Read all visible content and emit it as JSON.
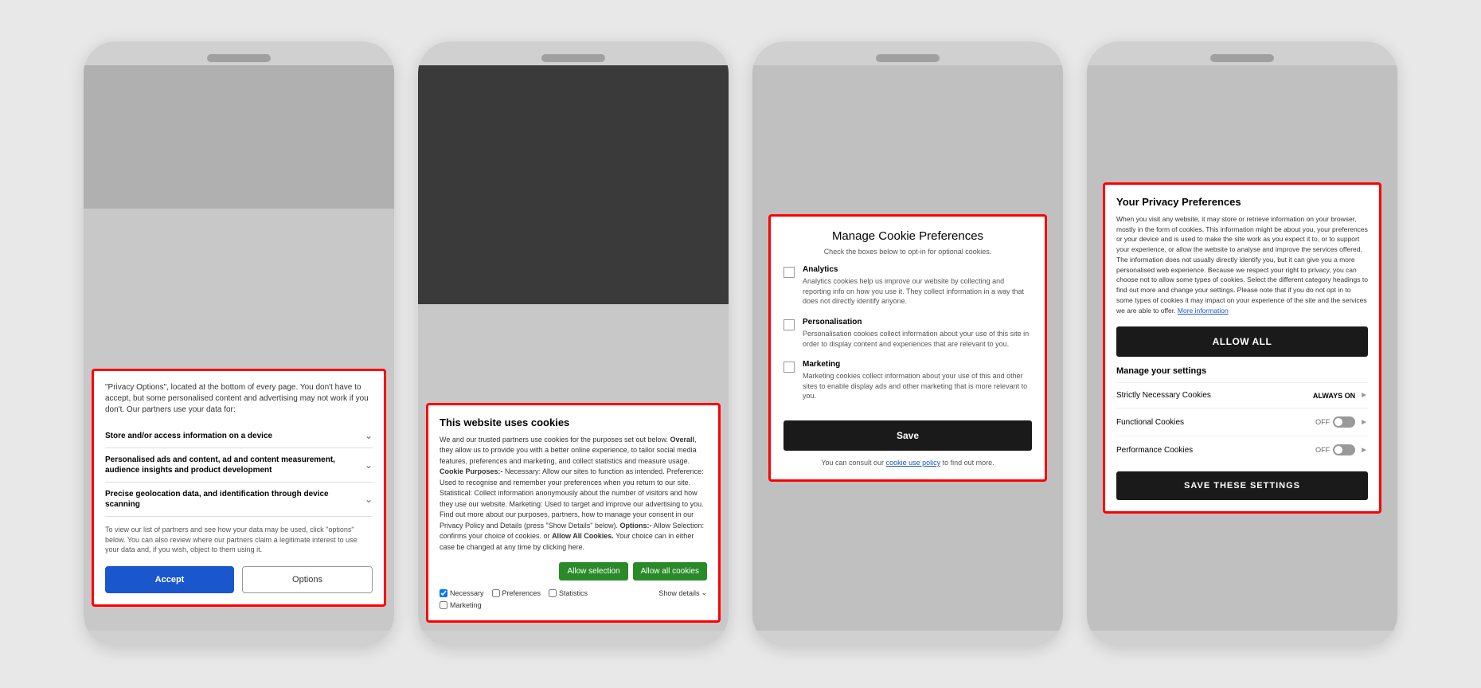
{
  "panel1": {
    "intro_text": "\"Privacy Options\", located at the bottom of every page. You don't have to accept, but some personalised content and advertising may not work if you don't. Our partners use your data for:",
    "items": [
      {
        "label": "Store and/or access information on a device"
      },
      {
        "label": "Personalised ads and content, ad and content measurement, audience insights and product development"
      },
      {
        "label": "Precise geolocation data, and identification through device scanning"
      }
    ],
    "partner_text": "To view our list of partners and see how your data may be used, click \"options\" below. You can also review where our partners claim a legitimate interest to use your data and, if you wish, object to them using it.",
    "accept_label": "Accept",
    "options_label": "Options"
  },
  "panel2": {
    "title": "This website uses cookies",
    "body_1": "We and our trusted partners use cookies for the purposes set out below. ",
    "body_bold_1": "Overall",
    "body_2": ", they allow us to provide you with a better online experience, to tailor social media features, preferences and marketing, and collect statistics and measure usage. ",
    "body_bold_2": "Cookie Purposes:-",
    "body_3": " Necessary: Allow our sites to function as intended. Preference: Used to recognise and remember your preferences when you return to our site. Statistical: Collect information anonymously about the number of visitors and how they use our website. Marketing: Used to target and improve our advertising to you. Find out more about our purposes, partners, how to manage your consent in our Privacy Policy and Details (press \"Show Details\" below). ",
    "body_bold_3": "Options:-",
    "body_4": " Allow Selection: confirms your choice of cookies. or ",
    "body_bold_4": "Allow All Cookies.",
    "body_5": " Your choice can in either case be changed at any time by clicking here.",
    "allow_selection_label": "Allow selection",
    "allow_all_label": "Allow all cookies",
    "checkboxes": [
      {
        "label": "Necessary",
        "checked": true
      },
      {
        "label": "Preferences",
        "checked": false
      },
      {
        "label": "Statistics",
        "checked": false
      },
      {
        "label": "Marketing",
        "checked": false
      }
    ],
    "show_details_label": "Show details"
  },
  "panel3": {
    "title": "Manage Cookie Preferences",
    "subtitle": "Check the boxes below to opt-in for optional cookies.",
    "items": [
      {
        "label": "Analytics",
        "description": "Analytics cookies help us improve our website by collecting and reporting info on how you use it. They collect information in a way that does not directly identify anyone.",
        "checked": false
      },
      {
        "label": "Personalisation",
        "description": "Personalisation cookies collect information about your use of this site in order to display content and experiences that are relevant to you.",
        "checked": false
      },
      {
        "label": "Marketing",
        "description": "Marketing cookies collect information about your use of this and other sites to enable display ads and other marketing that is more relevant to you.",
        "checked": false
      }
    ],
    "save_label": "Save",
    "policy_text": "You can consult our",
    "policy_link": "cookie use policy",
    "policy_text2": "to find out more."
  },
  "panel4": {
    "title": "Your Privacy Preferences",
    "body": "When you visit any website, it may store or retrieve information on your browser, mostly in the form of cookies. This information might be about you, your preferences or your device and is used to make the site work as you expect it to, or to support your experience, or allow the website to analyse and improve the services offered. The information does not usually directly identify you, but it can give you a more personalised web experience. Because we respect your right to privacy, you can choose not to allow some types of cookies. Select the different category headings to find out more and change your settings. Please note that if you do not opt in to some types of cookies it may impact on your experience of the site and the services we are able to offer.",
    "more_info_link": "More information",
    "allow_all_label": "ALLOW ALL",
    "manage_settings_label": "Manage your settings",
    "settings": [
      {
        "label": "Strictly Necessary Cookies",
        "status": "ALWAYS ON",
        "type": "always"
      },
      {
        "label": "Functional Cookies",
        "status": "OFF",
        "type": "toggle"
      },
      {
        "label": "Performance Cookies",
        "status": "OFF",
        "type": "toggle"
      }
    ],
    "save_label": "SAVE THESE SETTINGS"
  }
}
